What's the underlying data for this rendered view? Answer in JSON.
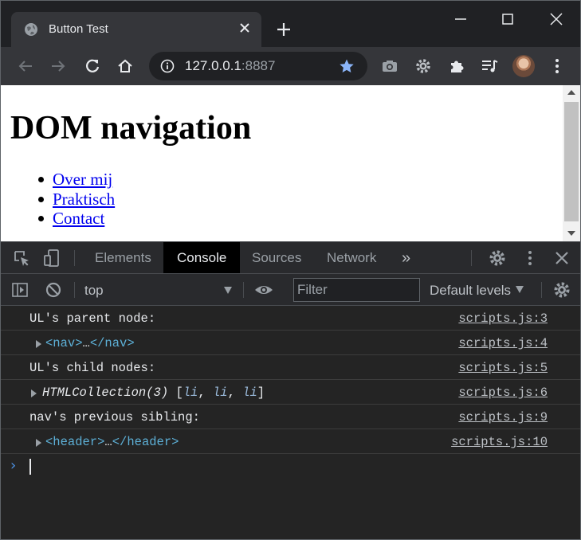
{
  "window": {
    "tab_title": "Button Test",
    "controls": [
      "minimize",
      "maximize",
      "close"
    ]
  },
  "toolbar": {
    "url_host": "127.0.0.1",
    "url_port": ":8887"
  },
  "page": {
    "heading": "DOM navigation",
    "nav_links": [
      "Over mij",
      "Praktisch",
      "Contact"
    ]
  },
  "devtools": {
    "tabs": [
      "Elements",
      "Console",
      "Sources",
      "Network"
    ],
    "active_tab": "Console",
    "more_tabs_glyph": "»",
    "context": "top",
    "filter_placeholder": "Filter",
    "levels": "Default levels",
    "messages": [
      {
        "text": "UL's parent node:",
        "source": "scripts.js:3"
      },
      {
        "open": "<nav>",
        "ellipsis": "…",
        "close": "</nav>",
        "source": "scripts.js:4"
      },
      {
        "text": "UL's child nodes:",
        "source": "scripts.js:5"
      },
      {
        "collection": "HTMLCollection(3)",
        "items": [
          "li",
          "li",
          "li"
        ],
        "source": "scripts.js:6"
      },
      {
        "text": "nav's previous sibling:",
        "source": "scripts.js:9"
      },
      {
        "open": "<header>",
        "ellipsis": "…",
        "close": "</header>",
        "source": "scripts.js:10"
      }
    ],
    "prompt_glyph": "›"
  },
  "colors": {
    "accent_blue": "#8ab4f8",
    "link": "#0000ee",
    "console_tag": "#5db0d7",
    "prompt": "#4d94e8"
  }
}
